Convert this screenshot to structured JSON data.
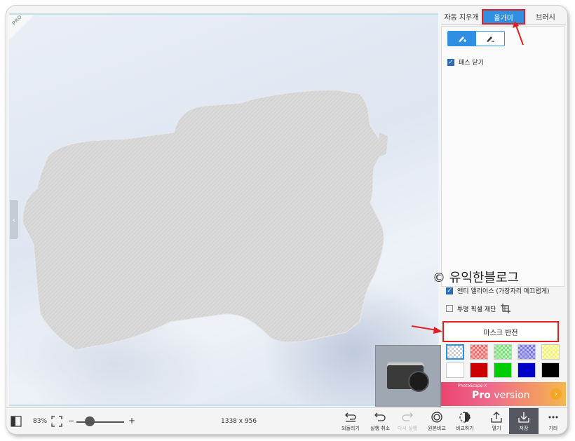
{
  "canvas": {
    "pro_ribbon": "PRO",
    "side_tab_icon": "chevron-left-icon"
  },
  "panel": {
    "tabs": [
      {
        "label": "자동 지우개",
        "active": false
      },
      {
        "label": "올가미",
        "active": true
      },
      {
        "label": "브러시",
        "active": false
      }
    ],
    "tools": [
      {
        "icon": "brush-add-icon",
        "selected": true
      },
      {
        "icon": "brush-remove-icon",
        "selected": false
      }
    ],
    "close_path": {
      "label": "패스 닫기",
      "checked": true
    },
    "anti_alias": {
      "label": "앤티 앨리어스 (가장자리 매끄럽게)",
      "checked": true
    },
    "crop_transparent": {
      "label": "투명 픽셀 재단",
      "checked": false
    },
    "mask_invert_label": "마스크 반전",
    "swatches": [
      "transparent",
      "#f07070",
      "#7de07d",
      "#7b7be8",
      "#f2f27a",
      "#ffffff",
      "#cc0000",
      "#00cc00",
      "#0000cc",
      "#000000"
    ],
    "promo": {
      "small": "PhotoScape X",
      "big_bold": "Pro",
      "big": " version"
    }
  },
  "watermark": "© 유익한블로그",
  "bottom": {
    "zoom": "83%",
    "zoom_minus": "−",
    "zoom_plus": "+",
    "image_size": "1338 x 956",
    "actions": [
      {
        "label": "되돌리기",
        "icon": "revert-icon",
        "enabled": true
      },
      {
        "label": "실행 취소",
        "icon": "undo-icon",
        "enabled": true
      },
      {
        "label": "다시 실행",
        "icon": "redo-icon",
        "enabled": false
      },
      {
        "label": "원본비교",
        "icon": "compare-original-icon",
        "enabled": true
      },
      {
        "label": "비교하기",
        "icon": "compare-icon",
        "enabled": true
      },
      {
        "label": "열기",
        "icon": "open-icon",
        "enabled": true
      },
      {
        "label": "저장",
        "icon": "save-icon",
        "enabled": true
      },
      {
        "label": "기타",
        "icon": "more-icon",
        "enabled": true
      }
    ]
  },
  "colors": {
    "accent": "#2f8fe3",
    "highlight": "#e02020"
  }
}
